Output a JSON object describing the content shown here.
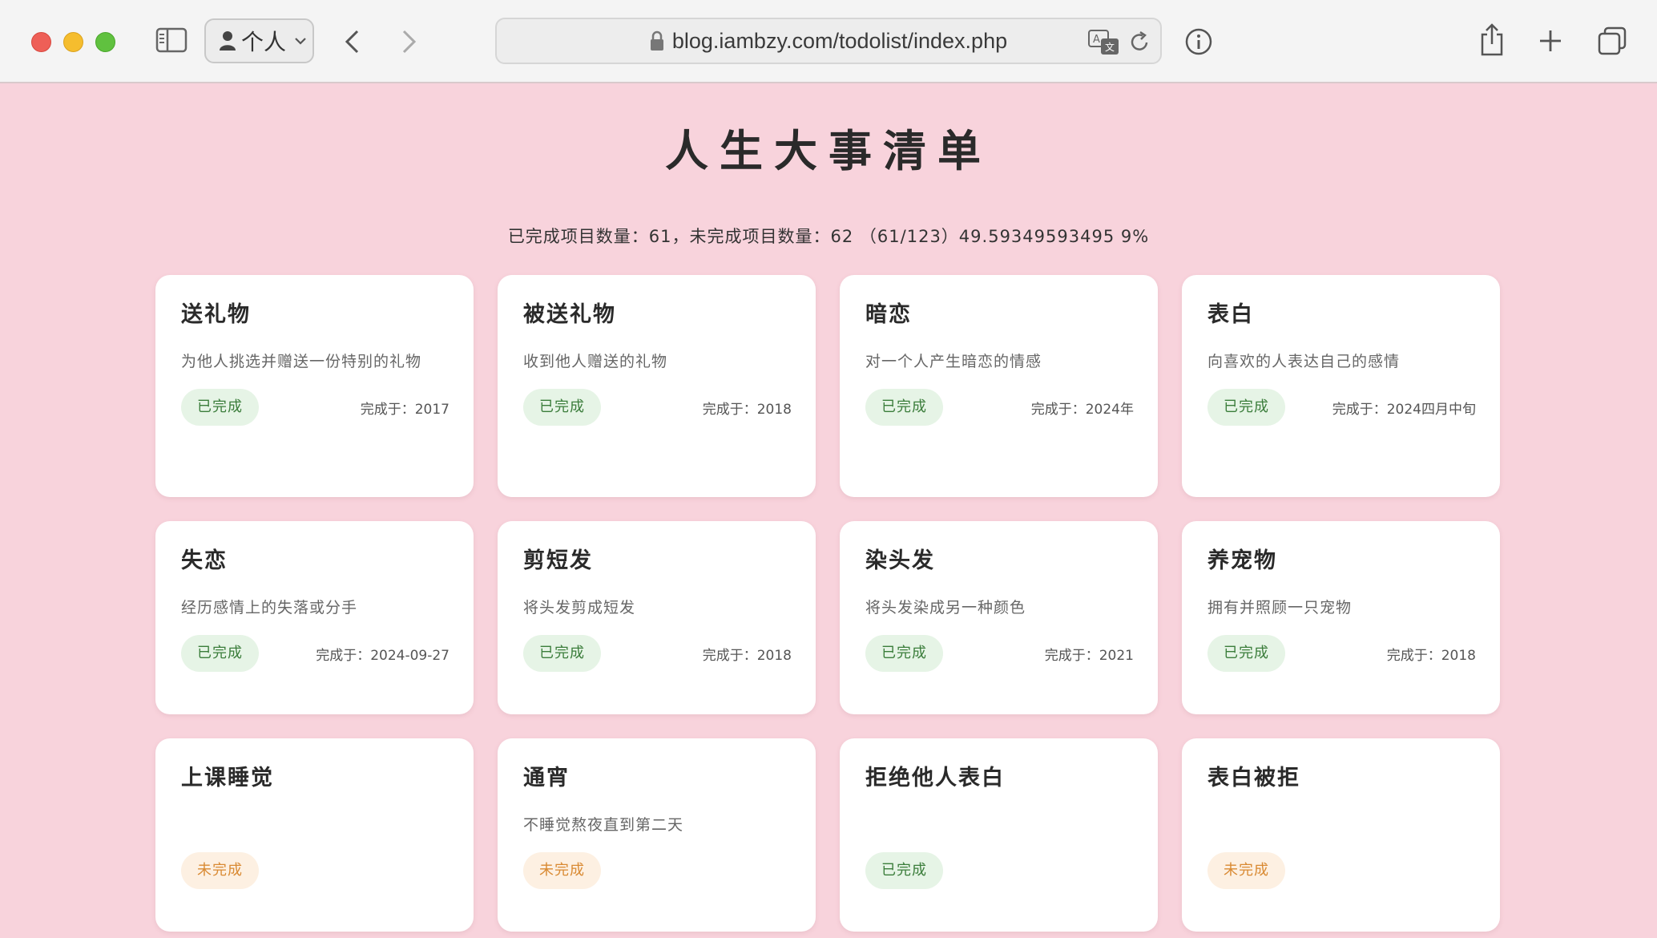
{
  "browser": {
    "profile_label": "个人",
    "url": "blog.iambzy.com/todolist/index.php"
  },
  "page": {
    "title": "人生大事清单",
    "stats": "已完成项目数量：61，未完成项目数量：62 （61/123）49.59349593495 9%"
  },
  "cards": [
    {
      "title": "送礼物",
      "desc": "为他人挑选并赠送一份特别的礼物",
      "status": "已完成",
      "date": "完成于：2017"
    },
    {
      "title": "被送礼物",
      "desc": "收到他人赠送的礼物",
      "status": "已完成",
      "date": "完成于：2018"
    },
    {
      "title": "暗恋",
      "desc": "对一个人产生暗恋的情感",
      "status": "已完成",
      "date": "完成于：2024年"
    },
    {
      "title": "表白",
      "desc": "向喜欢的人表达自己的感情",
      "status": "已完成",
      "date": "完成于：2024四月中旬"
    },
    {
      "title": "失恋",
      "desc": "经历感情上的失落或分手",
      "status": "已完成",
      "date": "完成于：2024-09-27"
    },
    {
      "title": "剪短发",
      "desc": "将头发剪成短发",
      "status": "已完成",
      "date": "完成于：2018"
    },
    {
      "title": "染头发",
      "desc": "将头发染成另一种颜色",
      "status": "已完成",
      "date": "完成于：2021"
    },
    {
      "title": "养宠物",
      "desc": "拥有并照顾一只宠物",
      "status": "已完成",
      "date": "完成于：2018"
    },
    {
      "title": "上课睡觉",
      "desc": "",
      "status": "未完成",
      "date": ""
    },
    {
      "title": "通宵",
      "desc": "不睡觉熬夜直到第二天",
      "status": "未完成",
      "date": ""
    },
    {
      "title": "拒绝他人表白",
      "desc": "",
      "status": "已完成",
      "date": ""
    },
    {
      "title": "表白被拒",
      "desc": "",
      "status": "未完成",
      "date": ""
    }
  ],
  "colors": {
    "page_bg": "#f8d3dc",
    "done_bg": "#e6f4e6",
    "done_text": "#3b7d3b",
    "todo_bg": "#fdf0e2",
    "todo_text": "#d98a33"
  }
}
